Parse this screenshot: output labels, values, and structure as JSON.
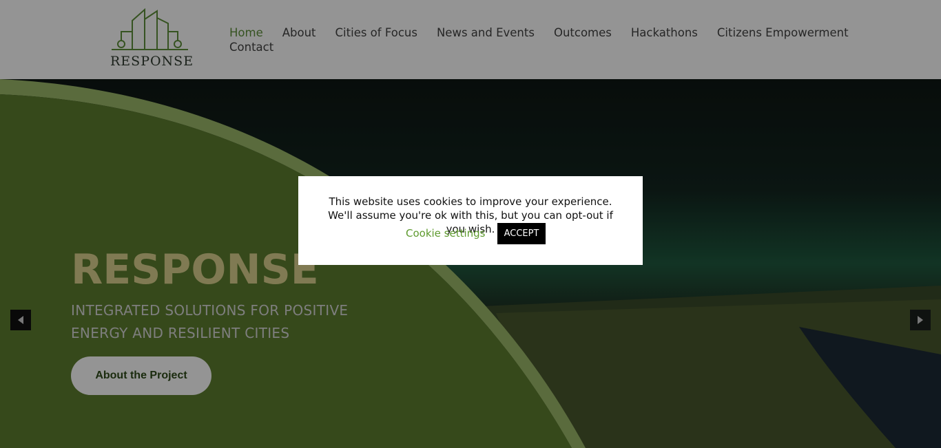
{
  "header": {
    "logo_text": "RESPONSE",
    "nav": [
      {
        "label": "Home",
        "active": true
      },
      {
        "label": "About"
      },
      {
        "label": "Cities of Focus"
      },
      {
        "label": "News and Events"
      },
      {
        "label": "Outcomes"
      },
      {
        "label": "Hackathons"
      },
      {
        "label": "Citizens Empowerment"
      },
      {
        "label": "Contact"
      }
    ]
  },
  "hero": {
    "title": "RESPONSE",
    "subtitle_line1": "INTEGRATED SOLUTIONS FOR POSITIVE",
    "subtitle_line2": "ENERGY AND RESILIENT CITIES",
    "button_label": "About the Project"
  },
  "cookie_banner": {
    "message": "This website uses cookies to improve your experience. We'll assume you're ok with this, but you can opt-out if you wish.",
    "settings_label": "Cookie settings",
    "accept_label": "ACCEPT"
  },
  "icons": {
    "prev": "caret-left-icon",
    "next": "caret-right-icon",
    "logo": "buildings-logo-icon"
  },
  "colors": {
    "accent_green": "#5e8f3a",
    "hero_title": "#dcd28f",
    "button_text": "#2e4a19"
  }
}
